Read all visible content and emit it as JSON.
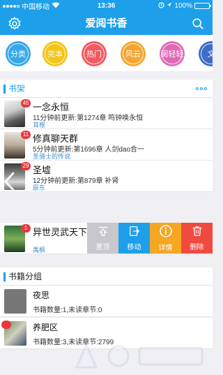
{
  "status_bar": {
    "carrier": "中国移动",
    "time": "13:36",
    "battery_percent": "100%",
    "battery_level": 1.0
  },
  "nav": {
    "title": "爱阅书香",
    "left_icon": "gear-icon",
    "right_icon": "search-icon"
  },
  "categories": [
    {
      "label": "分类",
      "color": "#35a7ea"
    },
    {
      "label": "完本",
      "color": "#f4c418"
    },
    {
      "label": "热门",
      "color": "#f05a61"
    },
    {
      "label": "风云",
      "color": "#f5a631"
    },
    {
      "label": "阅轻轻",
      "color": "#e068b6"
    },
    {
      "label": "文",
      "color": "#3f6cc8"
    }
  ],
  "bookshelf": {
    "title": "书架",
    "books": [
      {
        "title": "一念永恒",
        "update": "11分钟前更新:第1274章 鸣钟唤永恒",
        "author": "耳根",
        "badge": "45"
      },
      {
        "title": "修真聊天群",
        "update": "5分钟前更新:第1696章 人剑dao合一",
        "author": "圣骑士的传说",
        "badge": "11"
      },
      {
        "title": "圣墟",
        "update": "12分钟前更新:第879章 补肾",
        "author": "辰东",
        "badge": "29"
      },
      {
        "title": "异世灵武天下",
        "update": "",
        "author": "禹枫",
        "badge": "1"
      }
    ],
    "swipe_actions": [
      {
        "label": "置顶",
        "icon": "pin-top-icon",
        "color": "#c7c7cc"
      },
      {
        "label": "移动",
        "icon": "move-icon",
        "color": "#1e9fea"
      },
      {
        "label": "详情",
        "icon": "info-icon",
        "color": "#f5a623"
      },
      {
        "label": "删除",
        "icon": "trash-icon",
        "color": "#f04a3e"
      }
    ]
  },
  "groups": {
    "title": "书籍分组",
    "items": [
      {
        "name": "夜思",
        "stats": "书籍数量:1,未读章节:0"
      },
      {
        "name": "养肥区",
        "stats": "书籍数量:3,未读章节:2799"
      }
    ]
  }
}
